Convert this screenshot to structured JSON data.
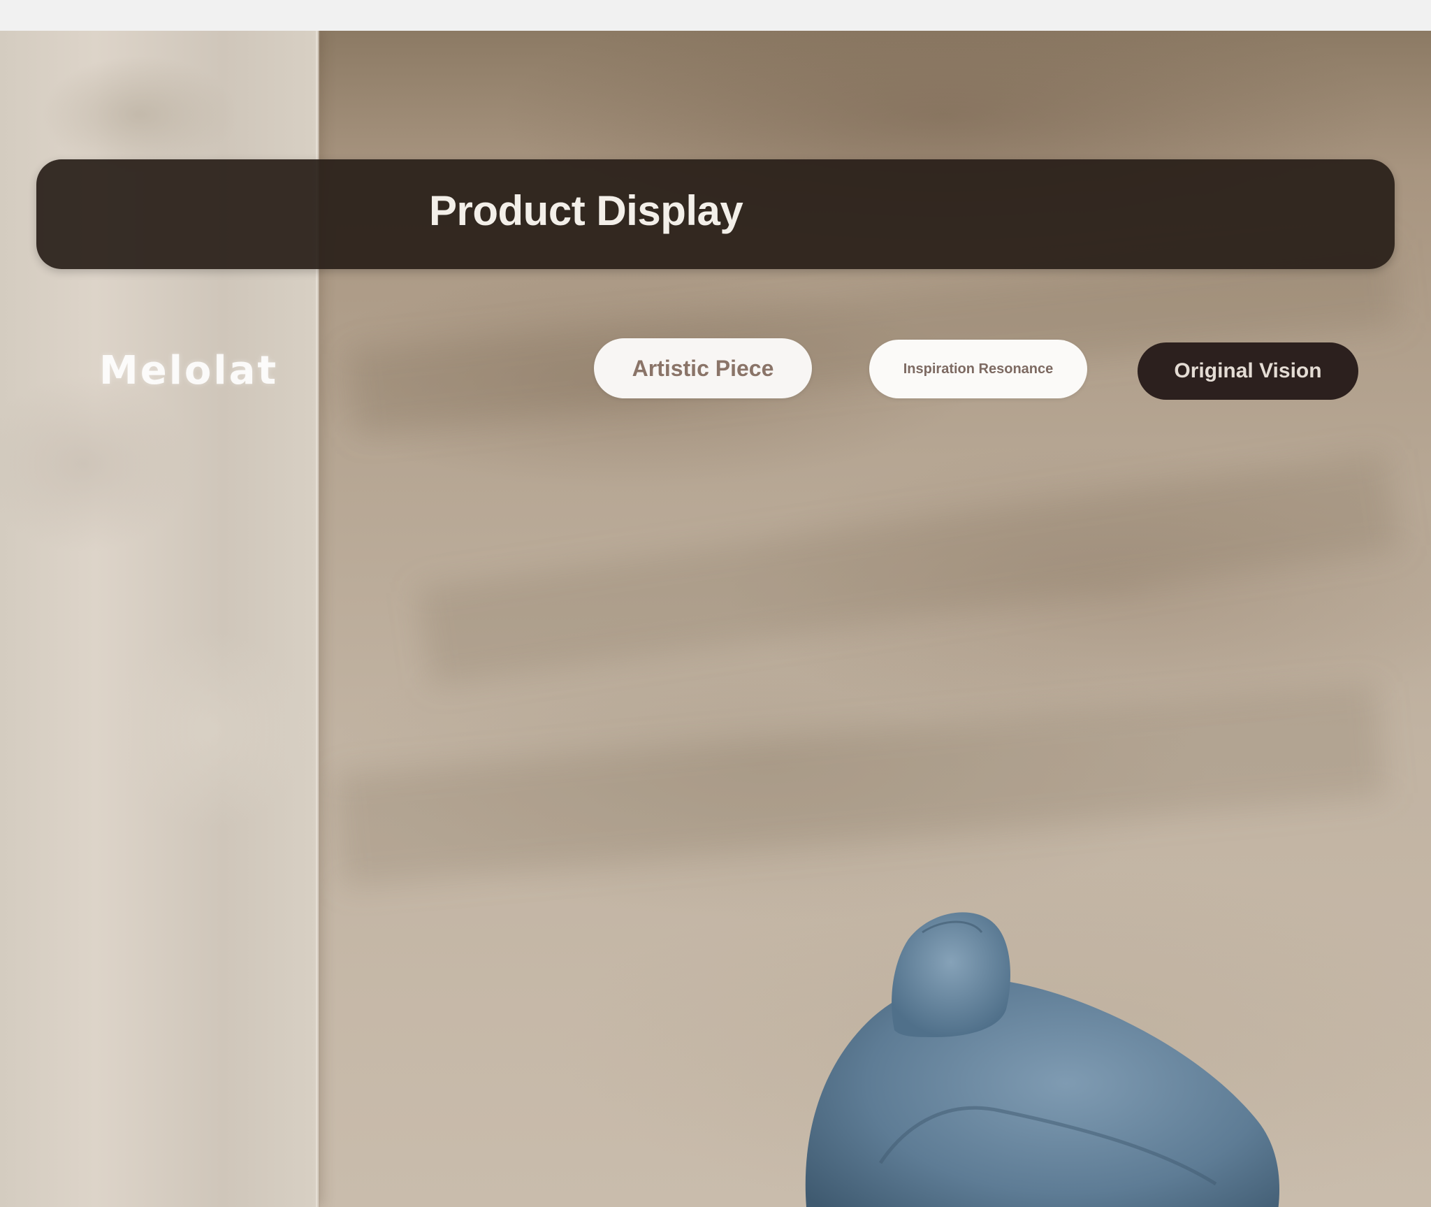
{
  "header": {
    "title": "Product Display"
  },
  "brand": {
    "name": "Melolat"
  },
  "nav": {
    "items": [
      {
        "label": "Artistic Piece"
      },
      {
        "label": "Inspiration Resonance"
      },
      {
        "label": "Original Vision"
      }
    ]
  },
  "colors": {
    "title_bar": "#2a1f1a",
    "active_pill": "#2c201e",
    "pill_light": "#f8f6f4",
    "sculpture": "#5e7c95"
  },
  "icons": {
    "hero_image": "blue-velvet-sculpture"
  }
}
